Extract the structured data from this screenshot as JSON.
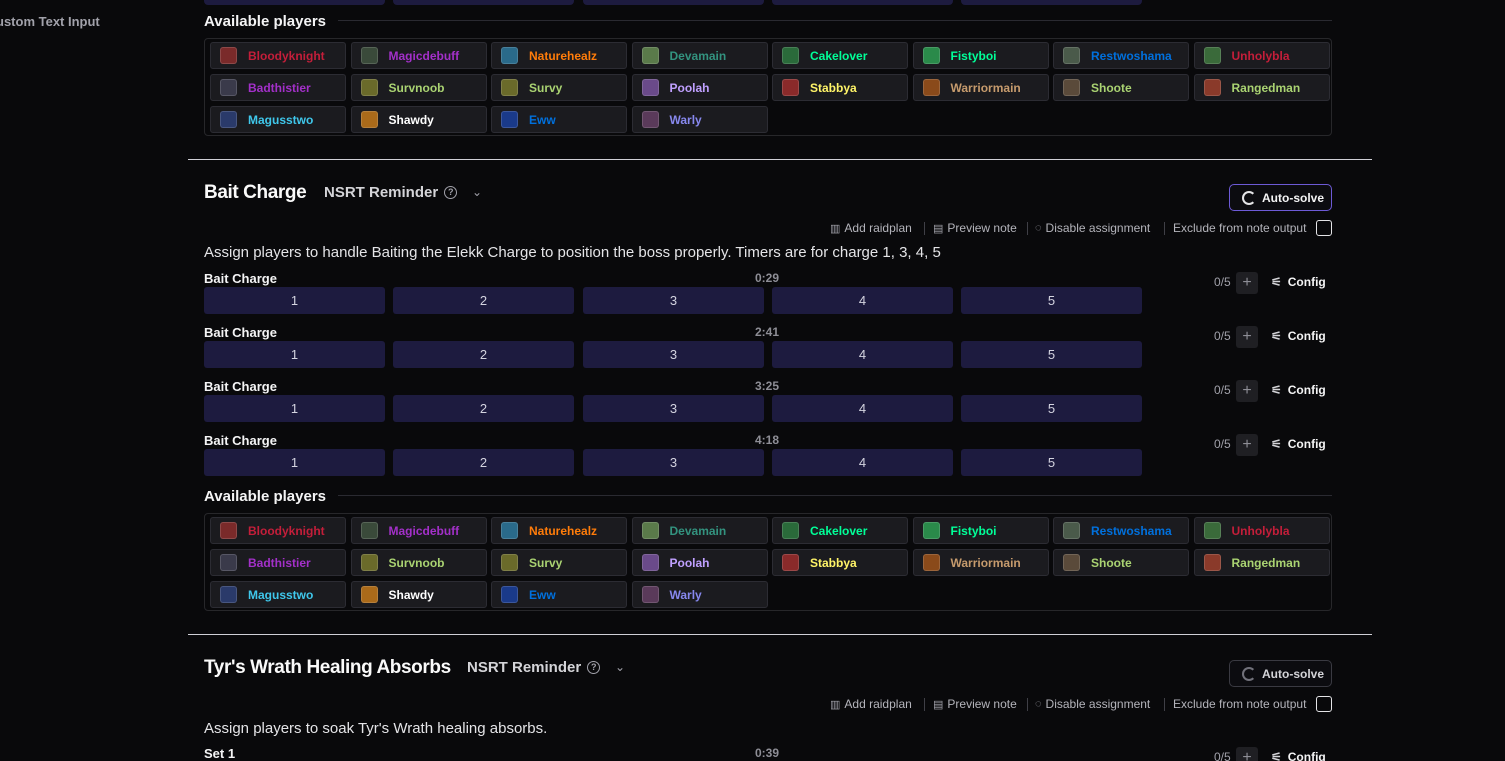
{
  "sidebar": {
    "custom_text_input": "ustom Text Input"
  },
  "available_players_title": "Available players",
  "players": [
    {
      "name": "Bloodyknight",
      "color": "#c41e3a",
      "icon": "#7a2a2a"
    },
    {
      "name": "Magicdebuff",
      "color": "#a330c9",
      "icon": "#3a4a3a"
    },
    {
      "name": "Naturehealz",
      "color": "#ff7c0a",
      "icon": "#2a6a8a"
    },
    {
      "name": "Devamain",
      "color": "#33937f",
      "icon": "#5a7a4a"
    },
    {
      "name": "Cakelover",
      "color": "#00ff98",
      "icon": "#2a6a3a"
    },
    {
      "name": "Fistyboi",
      "color": "#00ff98",
      "icon": "#2a8a4a"
    },
    {
      "name": "Restwoshama",
      "color": "#0070dd",
      "icon": "#4a5a4a"
    },
    {
      "name": "Unholybla",
      "color": "#c41e3a",
      "icon": "#3a6a3a"
    },
    {
      "name": "Badthistier",
      "color": "#a330c9",
      "icon": "#3a3a4a"
    },
    {
      "name": "Survnoob",
      "color": "#aad372",
      "icon": "#6a6a2a"
    },
    {
      "name": "Survy",
      "color": "#aad372",
      "icon": "#6a6a2a"
    },
    {
      "name": "Poolah",
      "color": "#c0a0ff",
      "icon": "#6a4a8a"
    },
    {
      "name": "Stabbya",
      "color": "#fff468",
      "icon": "#8a2a2a"
    },
    {
      "name": "Warriormain",
      "color": "#c69b6d",
      "icon": "#8a4a1a"
    },
    {
      "name": "Shoote",
      "color": "#aad372",
      "icon": "#5a4a3a"
    },
    {
      "name": "Rangedman",
      "color": "#aad372",
      "icon": "#8a3a2a"
    },
    {
      "name": "Magusstwo",
      "color": "#3fc7eb",
      "icon": "#2a3a6a"
    },
    {
      "name": "Shawdy",
      "color": "#ffffff",
      "icon": "#aa6a1a"
    },
    {
      "name": "Eww",
      "color": "#0070dd",
      "icon": "#1a3a8a"
    },
    {
      "name": "Warly",
      "color": "#8788ee",
      "icon": "#5a3a5a"
    }
  ],
  "toolbar": {
    "add_raidplan": "Add raidplan",
    "preview_note": "Preview note",
    "disable_assignment": "Disable assignment",
    "exclude_from_note": "Exclude from note output"
  },
  "autosolve_label": "Auto-solve",
  "config_label": "Config",
  "sections": [
    {
      "title": "Bait Charge",
      "reminder": "NSRT Reminder",
      "description": "Assign players to handle Baiting the Elekk Charge to position the boss properly. Timers are for charge 1, 3, 4, 5",
      "rows": [
        {
          "label": "Bait Charge",
          "time": "0:29",
          "count": "0/5",
          "slots": [
            "1",
            "2",
            "3",
            "4",
            "5"
          ]
        },
        {
          "label": "Bait Charge",
          "time": "2:41",
          "count": "0/5",
          "slots": [
            "1",
            "2",
            "3",
            "4",
            "5"
          ]
        },
        {
          "label": "Bait Charge",
          "time": "3:25",
          "count": "0/5",
          "slots": [
            "1",
            "2",
            "3",
            "4",
            "5"
          ]
        },
        {
          "label": "Bait Charge",
          "time": "4:18",
          "count": "0/5",
          "slots": [
            "1",
            "2",
            "3",
            "4",
            "5"
          ]
        }
      ]
    },
    {
      "title": "Tyr's Wrath Healing Absorbs",
      "reminder": "NSRT Reminder",
      "description": "Assign players to soak Tyr's Wrath healing absorbs.",
      "rows": [
        {
          "label": "Set 1",
          "time": "0:39",
          "count": "0/5",
          "slots": []
        }
      ]
    }
  ]
}
